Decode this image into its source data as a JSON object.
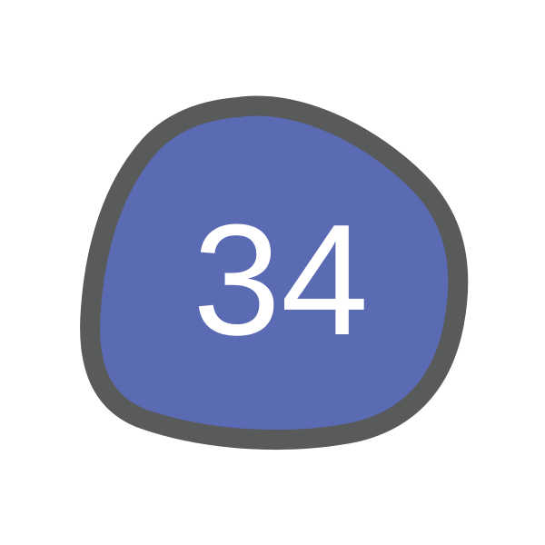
{
  "badge": {
    "number": "34",
    "fill_color": "#5a6ab3",
    "stroke_color": "#595a5a",
    "text_color": "#ffffff"
  }
}
